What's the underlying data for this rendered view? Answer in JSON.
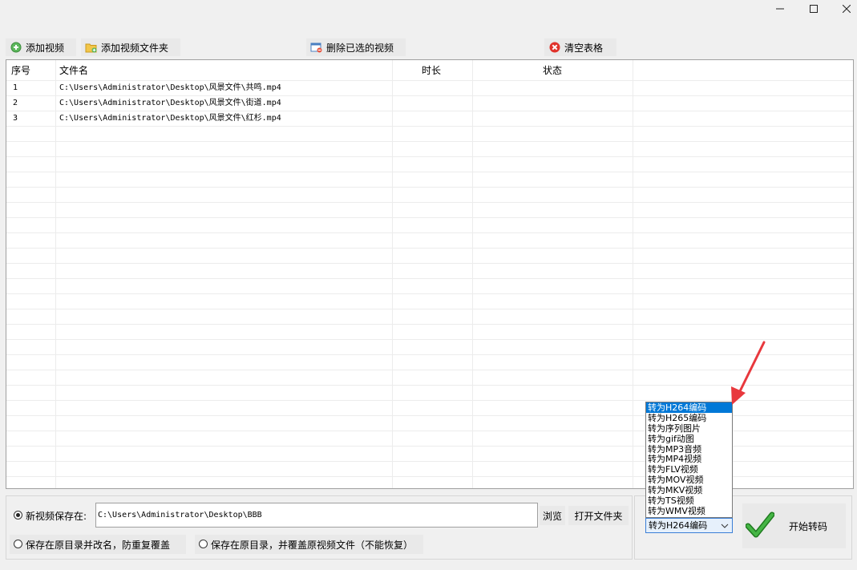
{
  "window": {
    "minimize_icon": "minimize-icon",
    "maximize_icon": "maximize-icon",
    "close_icon": "close-icon"
  },
  "toolbar": {
    "add_video": "添加视频",
    "add_folder": "添加视频文件夹",
    "delete_selected": "删除已选的视频",
    "clear_table": "清空表格"
  },
  "table": {
    "columns": [
      "序号",
      "文件名",
      "时长",
      "状态"
    ],
    "rows": [
      {
        "index": "1",
        "file": "C:\\Users\\Administrator\\Desktop\\风景文件\\共鸣.mp4",
        "duration": "",
        "status": ""
      },
      {
        "index": "2",
        "file": "C:\\Users\\Administrator\\Desktop\\风景文件\\街道.mp4",
        "duration": "",
        "status": ""
      },
      {
        "index": "3",
        "file": "C:\\Users\\Administrator\\Desktop\\风景文件\\红杉.mp4",
        "duration": "",
        "status": ""
      }
    ]
  },
  "output": {
    "new_path_label": "新视频保存在:",
    "path_value": "C:\\Users\\Administrator\\Desktop\\BBB",
    "browse": "浏览",
    "open_folder": "打开文件夹",
    "save_rename": "保存在原目录并改名，防重复覆盖",
    "save_overwrite": "保存在原目录，并覆盖原视频文件（不能恢复）"
  },
  "convert": {
    "options": [
      "转为H264编码",
      "转为H265编码",
      "转为序列图片",
      "转为gif动图",
      "转为MP3音频",
      "转为MP4视频",
      "转为FLV视频",
      "转为MOV视频",
      "转为MKV视频",
      "转为TS视频",
      "转为WMV视频"
    ],
    "selected": "转为H264编码",
    "start_button": "开始转码"
  },
  "colors": {
    "accent": "#0078d7",
    "arrow": "#e8383d",
    "check": "#2e9b2e"
  }
}
